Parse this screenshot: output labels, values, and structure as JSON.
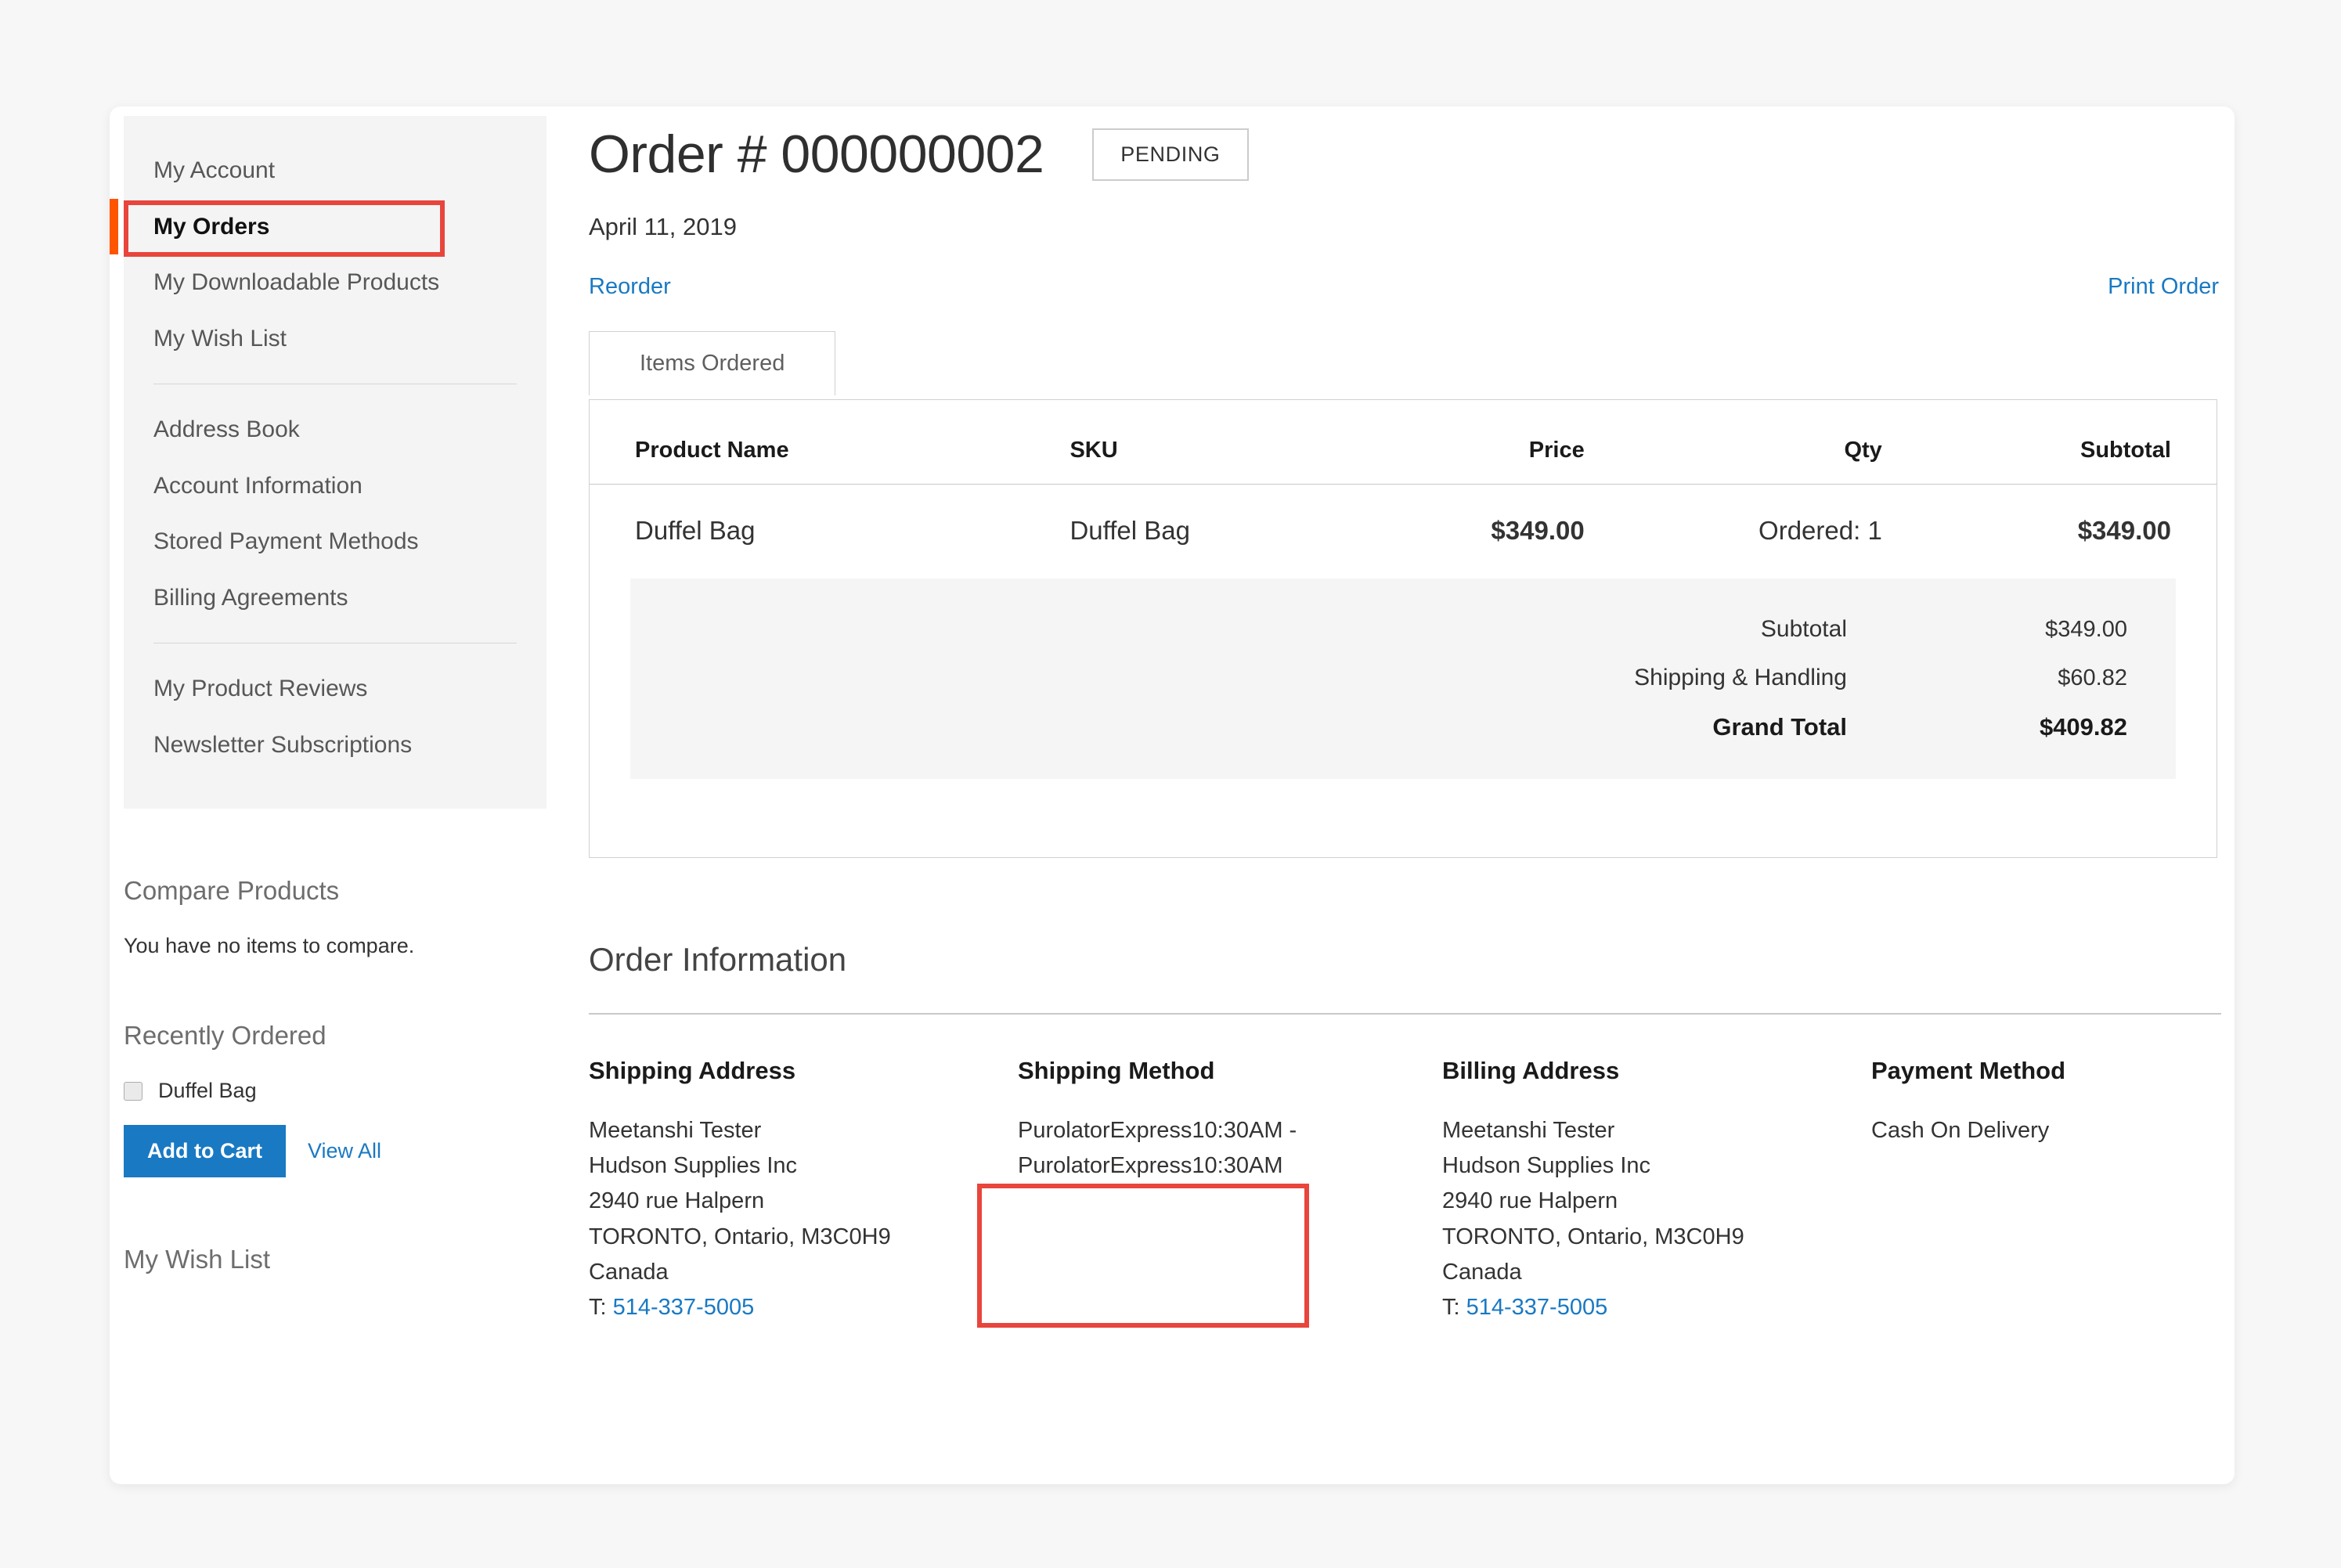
{
  "sidebar": {
    "nav_group_1": [
      {
        "label": "My Account",
        "current": false
      },
      {
        "label": "My Orders",
        "current": true
      },
      {
        "label": "My Downloadable Products",
        "current": false
      },
      {
        "label": "My Wish List",
        "current": false
      }
    ],
    "nav_group_2": [
      {
        "label": "Address Book"
      },
      {
        "label": "Account Information"
      },
      {
        "label": "Stored Payment Methods"
      },
      {
        "label": "Billing Agreements"
      }
    ],
    "nav_group_3": [
      {
        "label": "My Product Reviews"
      },
      {
        "label": "Newsletter Subscriptions"
      }
    ],
    "compare": {
      "title": "Compare Products",
      "empty_text": "You have no items to compare."
    },
    "recently_ordered": {
      "title": "Recently Ordered",
      "items": [
        {
          "label": "Duffel Bag",
          "checked": false
        }
      ],
      "add_to_cart_label": "Add to Cart",
      "view_all_label": "View All"
    },
    "wish_list_title": "My Wish List"
  },
  "main": {
    "order_title": "Order # 000000002",
    "status_badge": "PENDING",
    "order_date": "April 11, 2019",
    "reorder_label": "Reorder",
    "print_order_label": "Print Order",
    "tabs": [
      {
        "label": "Items Ordered",
        "active": true
      }
    ],
    "items_table": {
      "columns": [
        "Product Name",
        "SKU",
        "Price",
        "Qty",
        "Subtotal"
      ],
      "rows": [
        {
          "product_name": "Duffel Bag",
          "sku": "Duffel Bag",
          "price": "$349.00",
          "qty": "Ordered: 1",
          "subtotal": "$349.00"
        }
      ]
    },
    "totals": [
      {
        "label": "Subtotal",
        "value": "$349.00",
        "grand": false
      },
      {
        "label": "Shipping & Handling",
        "value": "$60.82",
        "grand": false
      },
      {
        "label": "Grand Total",
        "value": "$409.82",
        "grand": true
      }
    ],
    "order_information": {
      "section_title": "Order Information",
      "shipping_address": {
        "heading": "Shipping Address",
        "lines": [
          "Meetanshi Tester",
          "Hudson Supplies Inc",
          "2940 rue Halpern",
          "TORONTO, Ontario, M3C0H9",
          "Canada"
        ],
        "phone_prefix": "T: ",
        "phone": "514-337-5005"
      },
      "shipping_method": {
        "heading": "Shipping Method",
        "line1": "PurolatorExpress10:30AM -",
        "line2": "PurolatorExpress10:30AM"
      },
      "billing_address": {
        "heading": "Billing Address",
        "lines": [
          "Meetanshi Tester",
          "Hudson Supplies Inc",
          "2940 rue Halpern",
          "TORONTO, Ontario, M3C0H9",
          "Canada"
        ],
        "phone_prefix": "T: ",
        "phone": "514-337-5005"
      },
      "payment_method": {
        "heading": "Payment Method",
        "value": "Cash On Delivery"
      }
    }
  },
  "colors": {
    "accent_orange": "#ff5501",
    "link_blue": "#1979c3",
    "annotation_red": "#e8453c",
    "panel_gray": "#f4f4f4"
  }
}
